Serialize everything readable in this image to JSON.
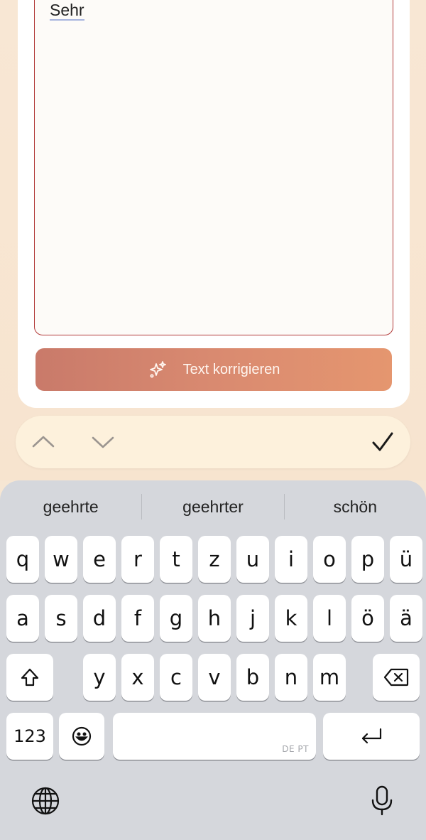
{
  "editor": {
    "text": "Sehr"
  },
  "actions": {
    "correct_label": "Text korrigieren"
  },
  "navbar": {
    "prev_icon": "chevron-up-icon",
    "next_icon": "chevron-down-icon",
    "done_icon": "checkmark-icon"
  },
  "keyboard": {
    "suggestions": [
      "geehrte",
      "geehrter",
      "schön"
    ],
    "row1": [
      "q",
      "w",
      "e",
      "r",
      "t",
      "z",
      "u",
      "i",
      "o",
      "p",
      "ü"
    ],
    "row2": [
      "a",
      "s",
      "d",
      "f",
      "g",
      "h",
      "j",
      "k",
      "l",
      "ö",
      "ä"
    ],
    "row3": [
      "y",
      "x",
      "c",
      "v",
      "b",
      "n",
      "m"
    ],
    "numbers_label": "123",
    "space_languages": "DE PT",
    "shift_icon": "shift-icon",
    "delete_icon": "backspace-icon",
    "emoji_icon": "emoji-icon",
    "return_icon": "return-icon",
    "globe_icon": "globe-icon",
    "mic_icon": "microphone-icon"
  },
  "colors": {
    "background": "#f8e7d4",
    "accent_start": "#c97a6a",
    "accent_end": "#e5966f",
    "textarea_border": "#b23a3a",
    "keyboard_bg": "#d5d7dc"
  }
}
